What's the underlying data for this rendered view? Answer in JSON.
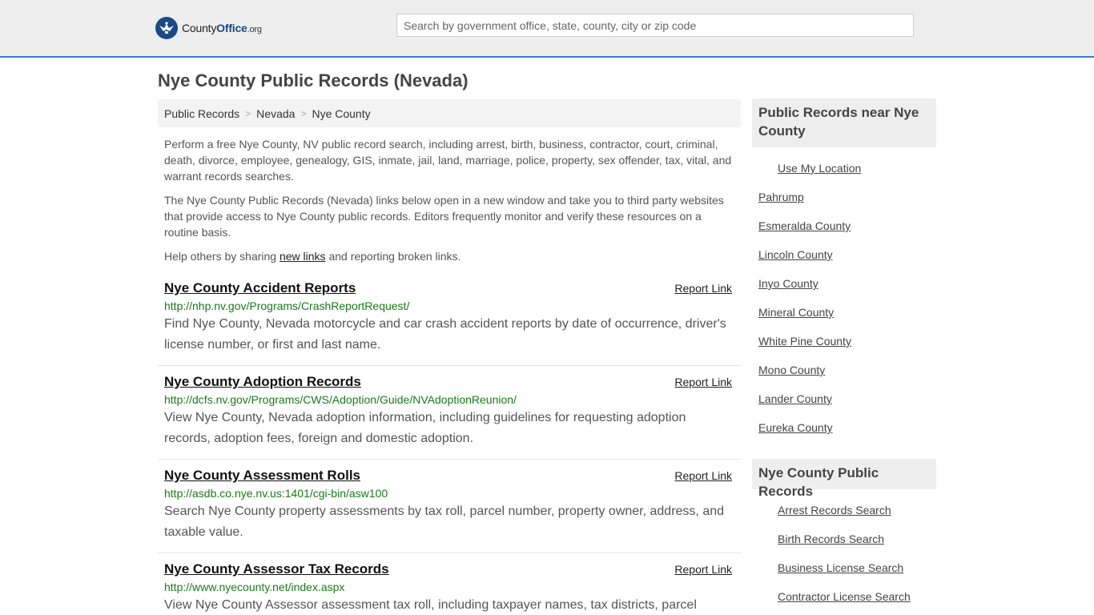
{
  "header": {
    "logo_word_1": "County",
    "logo_word_2": "Office",
    "logo_suffix": ".org",
    "search_placeholder": "Search by government office, state, county, city or zip code"
  },
  "page": {
    "title": "Nye County Public Records (Nevada)"
  },
  "breadcrumb": [
    "Public Records",
    "Nevada",
    "Nye County"
  ],
  "intro": {
    "p1": "Perform a free Nye County, NV public record search, including arrest, birth, business, contractor, court, criminal, death, divorce, employee, genealogy, GIS, inmate, jail, land, marriage, police, property, sex offender, tax, vital, and warrant records searches.",
    "p2": "The Nye County Public Records (Nevada) links below open in a new window and take you to third party websites that provide access to Nye County public records. Editors frequently monitor and verify these resources on a routine basis.",
    "p3_before": "Help others by sharing ",
    "p3_link": "new links",
    "p3_after": " and reporting broken links."
  },
  "records": [
    {
      "title": "Nye County Accident Reports",
      "report": "Report Link",
      "url": "http://nhp.nv.gov/Programs/CrashReportRequest/",
      "desc": "Find Nye County, Nevada motorcycle and car crash accident reports by date of occurrence, driver's license number, or first and last name."
    },
    {
      "title": "Nye County Adoption Records",
      "report": "Report Link",
      "url": "http://dcfs.nv.gov/Programs/CWS/Adoption/Guide/NVAdoptionReunion/",
      "desc": "View Nye County, Nevada adoption information, including guidelines for requesting adoption records, adoption fees, foreign and domestic adoption."
    },
    {
      "title": "Nye County Assessment Rolls",
      "report": "Report Link",
      "url": "http://asdb.co.nye.nv.us:1401/cgi-bin/asw100",
      "desc": "Search Nye County property assessments by tax roll, parcel number, property owner, address, and taxable value."
    },
    {
      "title": "Nye County Assessor Tax Records",
      "report": "Report Link",
      "url": "http://www.nyecounty.net/index.aspx",
      "desc": "View Nye County Assessor assessment tax roll, including taxpayer names, tax districts, parcel"
    }
  ],
  "sidebar": {
    "near_title": "Public Records near Nye County",
    "use_location": "Use My Location",
    "near_links": [
      "Pahrump",
      "Esmeralda County",
      "Lincoln County",
      "Inyo County",
      "Mineral County",
      "White Pine County",
      "Mono County",
      "Lander County",
      "Eureka County"
    ],
    "county_title": "Nye County Public Records",
    "county_links": [
      "Arrest Records Search",
      "Birth Records Search",
      "Business License Search",
      "Contractor License Search"
    ]
  },
  "colors": {
    "accent": "#3a7bd5",
    "logo": "#1a4a85",
    "url_green": "#1a7a1a"
  }
}
